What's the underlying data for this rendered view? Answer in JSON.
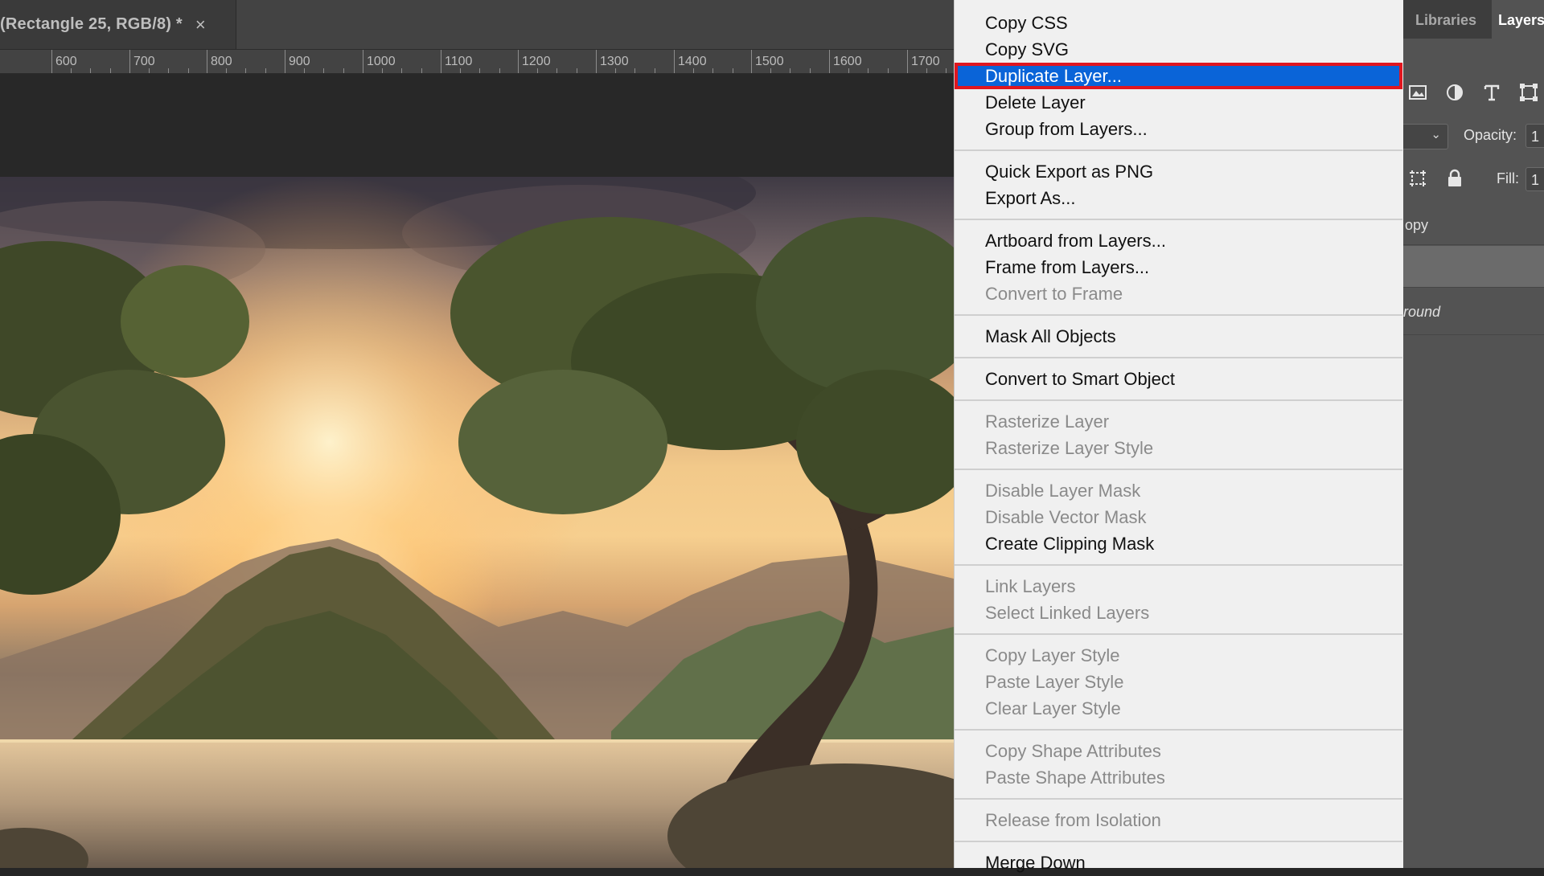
{
  "document": {
    "tab_title": "(Rectangle 25, RGB/8) *",
    "close_glyph": "×"
  },
  "ruler": {
    "labels": [
      "600",
      "700",
      "800",
      "900",
      "1000",
      "1100",
      "1200",
      "1300",
      "1400",
      "1500",
      "1600",
      "1700"
    ]
  },
  "context_menu": {
    "groups": [
      [
        {
          "label": "Copy CSS",
          "enabled": true
        },
        {
          "label": "Copy SVG",
          "enabled": true
        },
        {
          "label": "Duplicate Layer...",
          "enabled": true,
          "highlighted": true
        },
        {
          "label": "Delete Layer",
          "enabled": true
        },
        {
          "label": "Group from Layers...",
          "enabled": true
        }
      ],
      [
        {
          "label": "Quick Export as PNG",
          "enabled": true
        },
        {
          "label": "Export As...",
          "enabled": true
        }
      ],
      [
        {
          "label": "Artboard from Layers...",
          "enabled": true
        },
        {
          "label": "Frame from Layers...",
          "enabled": true
        },
        {
          "label": "Convert to Frame",
          "enabled": false
        }
      ],
      [
        {
          "label": "Mask All Objects",
          "enabled": true
        }
      ],
      [
        {
          "label": "Convert to Smart Object",
          "enabled": true
        }
      ],
      [
        {
          "label": "Rasterize Layer",
          "enabled": false
        },
        {
          "label": "Rasterize Layer Style",
          "enabled": false
        }
      ],
      [
        {
          "label": "Disable Layer Mask",
          "enabled": false
        },
        {
          "label": "Disable Vector Mask",
          "enabled": false
        },
        {
          "label": "Create Clipping Mask",
          "enabled": true
        }
      ],
      [
        {
          "label": "Link Layers",
          "enabled": false
        },
        {
          "label": "Select Linked Layers",
          "enabled": false
        }
      ],
      [
        {
          "label": "Copy Layer Style",
          "enabled": false
        },
        {
          "label": "Paste Layer Style",
          "enabled": false
        },
        {
          "label": "Clear Layer Style",
          "enabled": false
        }
      ],
      [
        {
          "label": "Copy Shape Attributes",
          "enabled": false
        },
        {
          "label": "Paste Shape Attributes",
          "enabled": false
        }
      ],
      [
        {
          "label": "Release from Isolation",
          "enabled": false
        }
      ],
      [
        {
          "label": "Merge Down",
          "enabled": true
        }
      ]
    ]
  },
  "right_panel": {
    "tabs": [
      {
        "label": "Libraries",
        "active": false
      },
      {
        "label": "Layers",
        "active": true
      }
    ],
    "filter_icons": [
      "image-filter-icon",
      "adjustment-filter-icon",
      "type-filter-icon",
      "shape-filter-icon"
    ],
    "opacity_label": "Opacity:",
    "opacity_value": "1",
    "fill_label": "Fill:",
    "fill_value": "1",
    "lock_icons": [
      "artboard-lock-icon",
      "lock-all-icon"
    ],
    "layers": [
      {
        "name": "opy",
        "selected": false
      },
      {
        "name": "",
        "selected": true
      },
      {
        "name": "round",
        "selected": false
      }
    ]
  },
  "colors": {
    "menu_highlight": "#0a64d8",
    "highlight_outline": "#e0161f",
    "menu_background": "#f0f0f0",
    "panel_background": "#535353"
  }
}
